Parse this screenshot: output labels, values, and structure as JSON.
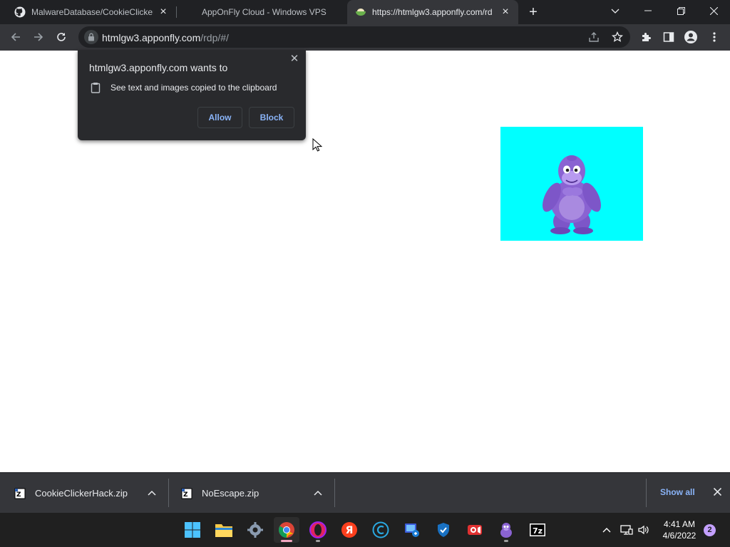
{
  "browser": {
    "tabs": [
      {
        "title": "MalwareDatabase/CookieClicker",
        "icon": "github-icon",
        "active": false
      },
      {
        "title": "AppOnFly Cloud - Windows VPS",
        "icon": "apponfly-icon",
        "active": false
      },
      {
        "title": "https://htmlgw3.apponfly.com/rd",
        "icon": "bowl-icon",
        "active": true
      }
    ],
    "new_tab_label": "+",
    "omnibox": {
      "host": "htmlgw3.apponfly.com",
      "path": "/rdp/#/"
    }
  },
  "permission_popup": {
    "title": "htmlgw3.apponfly.com wants to",
    "permission": "See text and images copied to the clipboard",
    "allow_label": "Allow",
    "block_label": "Block",
    "close_glyph": "✕"
  },
  "downloads": {
    "items": [
      {
        "name": "CookieClickerHack.zip",
        "icon": "7zip-archive-icon"
      },
      {
        "name": "NoEscape.zip",
        "icon": "7zip-archive-icon"
      }
    ],
    "show_all_label": "Show all"
  },
  "taskbar": {
    "apps": [
      {
        "name": "start-button",
        "icon": "windows-logo-icon"
      },
      {
        "name": "file-explorer",
        "icon": "folder-icon"
      },
      {
        "name": "settings",
        "icon": "gear-icon"
      },
      {
        "name": "chrome",
        "icon": "chrome-icon",
        "active": true
      },
      {
        "name": "opera",
        "icon": "opera-icon"
      },
      {
        "name": "yandex",
        "icon": "yandex-icon"
      },
      {
        "name": "ccleaner",
        "icon": "ccleaner-icon"
      },
      {
        "name": "remote-desktop",
        "icon": "remote-desktop-icon"
      },
      {
        "name": "security",
        "icon": "shield-icon"
      },
      {
        "name": "screen-recorder",
        "icon": "recorder-icon"
      },
      {
        "name": "bonzibuddy",
        "icon": "bonzi-icon"
      },
      {
        "name": "7zip",
        "icon": "7zip-icon"
      }
    ],
    "clock": {
      "time": "4:41 AM",
      "date": "4/6/2022"
    },
    "notification_count": "2"
  },
  "colors": {
    "chrome_dark": "#202124",
    "toolbar": "#35363a",
    "link_blue": "#8ab4f8",
    "bonzi_bg": "#00ffff",
    "bonzi_purple": "#8a63d2"
  }
}
